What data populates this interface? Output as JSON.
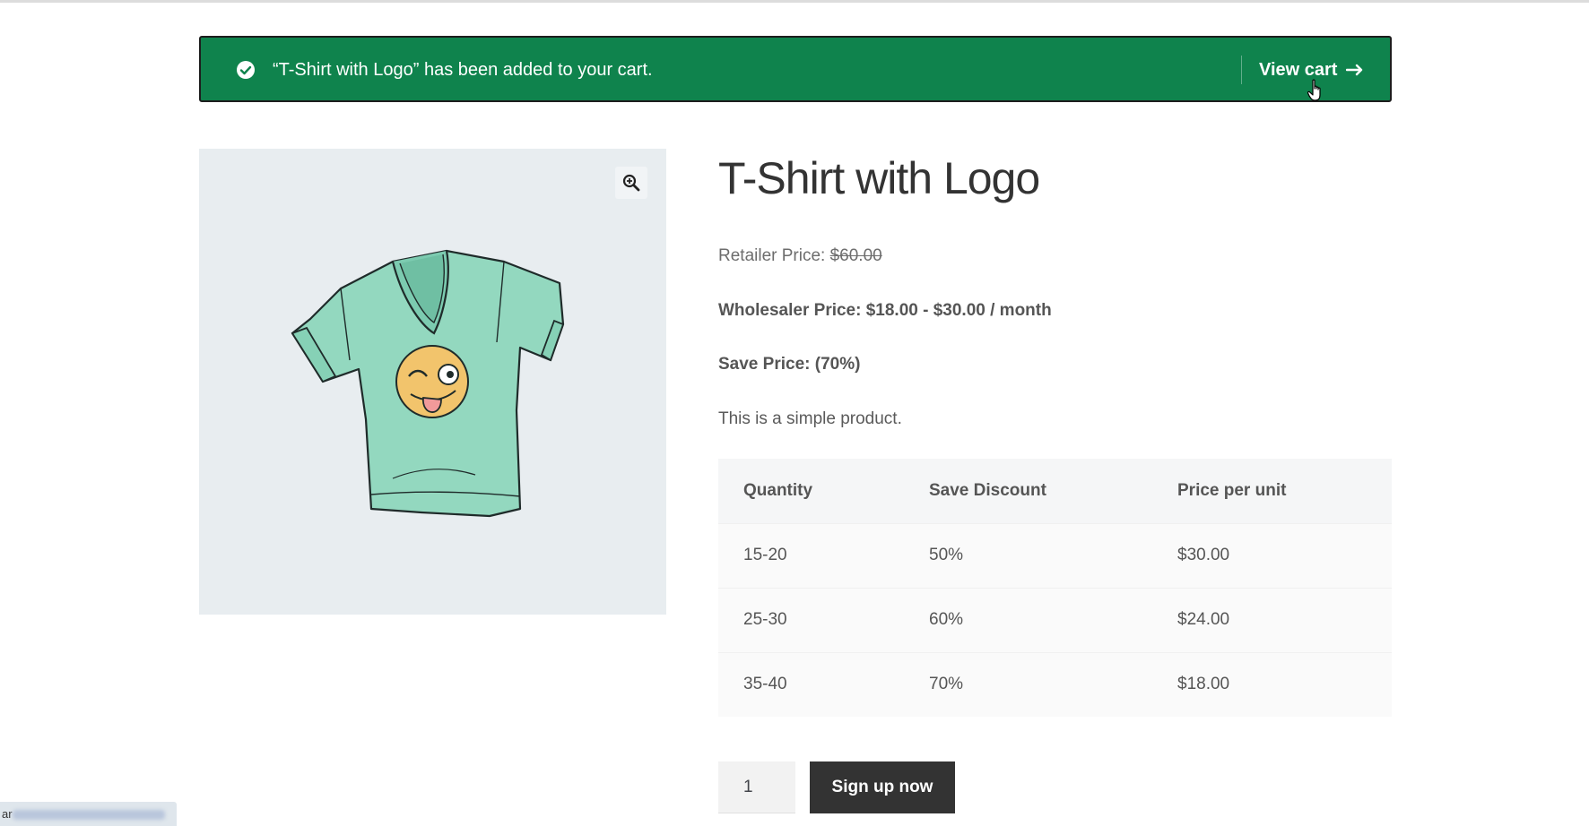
{
  "notice": {
    "message": "“T-Shirt with Logo” has been added to your cart.",
    "view_cart_label": "View cart",
    "colors": {
      "background": "#0f834d",
      "text": "#ffffff"
    }
  },
  "gallery": {
    "zoom_icon": "zoom-in-icon",
    "image": "t-shirt-with-logo"
  },
  "product": {
    "title": "T-Shirt with Logo",
    "retailer_label": "Retailer Price: ",
    "retailer_price": "$60.00",
    "wholesaler_price": "Wholesaler Price: $18.00 - $30.00 / month",
    "save_price": "Save Price: (70%)",
    "description": "This is a simple product."
  },
  "tiers": {
    "headers": [
      "Quantity",
      "Save Discount",
      "Price per unit"
    ],
    "rows": [
      [
        "15-20",
        "50%",
        "$30.00"
      ],
      [
        "25-30",
        "60%",
        "$24.00"
      ],
      [
        "35-40",
        "70%",
        "$18.00"
      ]
    ]
  },
  "cart_form": {
    "quantity": "1",
    "submit_label": "Sign up now"
  },
  "status_bar": {
    "prefix": "ar"
  }
}
